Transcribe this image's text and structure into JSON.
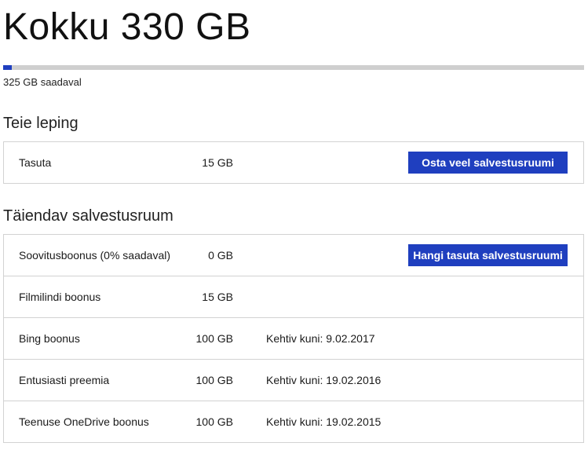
{
  "storage": {
    "total_label": "Kokku 330 GB",
    "available_label": "325 GB saadaval",
    "used_fraction": 0.015
  },
  "plan_section": {
    "title": "Teie leping",
    "rows": [
      {
        "name": "Tasuta",
        "size": "15 GB",
        "button": "Osta veel salvestusruumi"
      }
    ]
  },
  "extra_section": {
    "title": "Täiendav salvestusruum",
    "rows": [
      {
        "name": "Soovitusboonus (0% saadaval)",
        "size": "0 GB",
        "expires": "",
        "button": "Hangi tasuta salvestusruumi"
      },
      {
        "name": "Filmilindi boonus",
        "size": "15 GB",
        "expires": ""
      },
      {
        "name": "Bing boonus",
        "size": "100 GB",
        "expires": "Kehtiv kuni: 9.02.2017"
      },
      {
        "name": "Entusiasti preemia",
        "size": "100 GB",
        "expires": "Kehtiv kuni: 19.02.2016"
      },
      {
        "name": "Teenuse OneDrive boonus",
        "size": "100 GB",
        "expires": "Kehtiv kuni: 19.02.2015"
      }
    ]
  },
  "colors": {
    "accent": "#1f3fbf",
    "bar_track": "#cfcfcf",
    "border": "#d2d2d2"
  }
}
